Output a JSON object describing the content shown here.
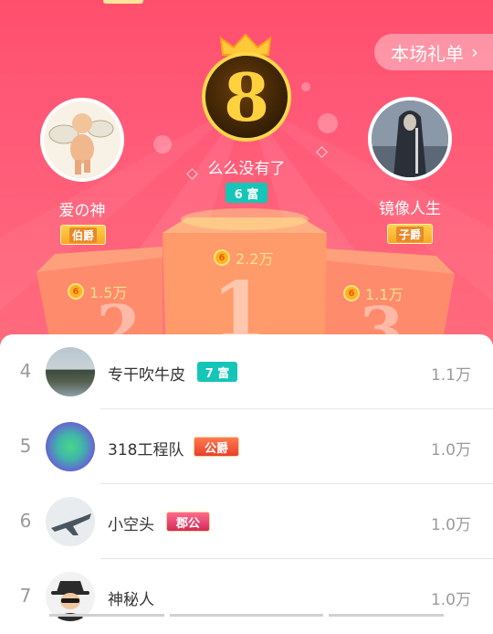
{
  "header": {
    "gift_list_label": "本场礼单",
    "gift_list_icon": "chevron-right-icon"
  },
  "podium": {
    "first": {
      "badge_number": "8",
      "name": "么么没有了",
      "tag": "6 富",
      "amount": "2.2万",
      "podium_number": "1"
    },
    "second": {
      "name": "爱の神",
      "tag": "伯爵",
      "amount": "1.5万",
      "podium_number": "2"
    },
    "third": {
      "name": "镜像人生",
      "tag": "子爵",
      "amount": "1.1万",
      "podium_number": "3"
    },
    "coin_glyph": "6"
  },
  "list": {
    "rows": [
      {
        "rank": "4",
        "name": "专干吹牛皮",
        "tag": "7 富",
        "tag_style": "teal",
        "amount": "1.1万"
      },
      {
        "rank": "5",
        "name": "318工程队",
        "tag": "公爵",
        "tag_style": "red",
        "amount": "1.0万"
      },
      {
        "rank": "6",
        "name": "小空头",
        "tag": "郡公",
        "tag_style": "purple",
        "amount": "1.0万"
      },
      {
        "rank": "7",
        "name": "神秘人",
        "tag": "",
        "tag_style": "",
        "amount": "1.0万"
      }
    ]
  },
  "colors": {
    "hero": "#ff5a78",
    "accent_gold": "#ffe28a",
    "teal_tag": "#15c5b7"
  }
}
